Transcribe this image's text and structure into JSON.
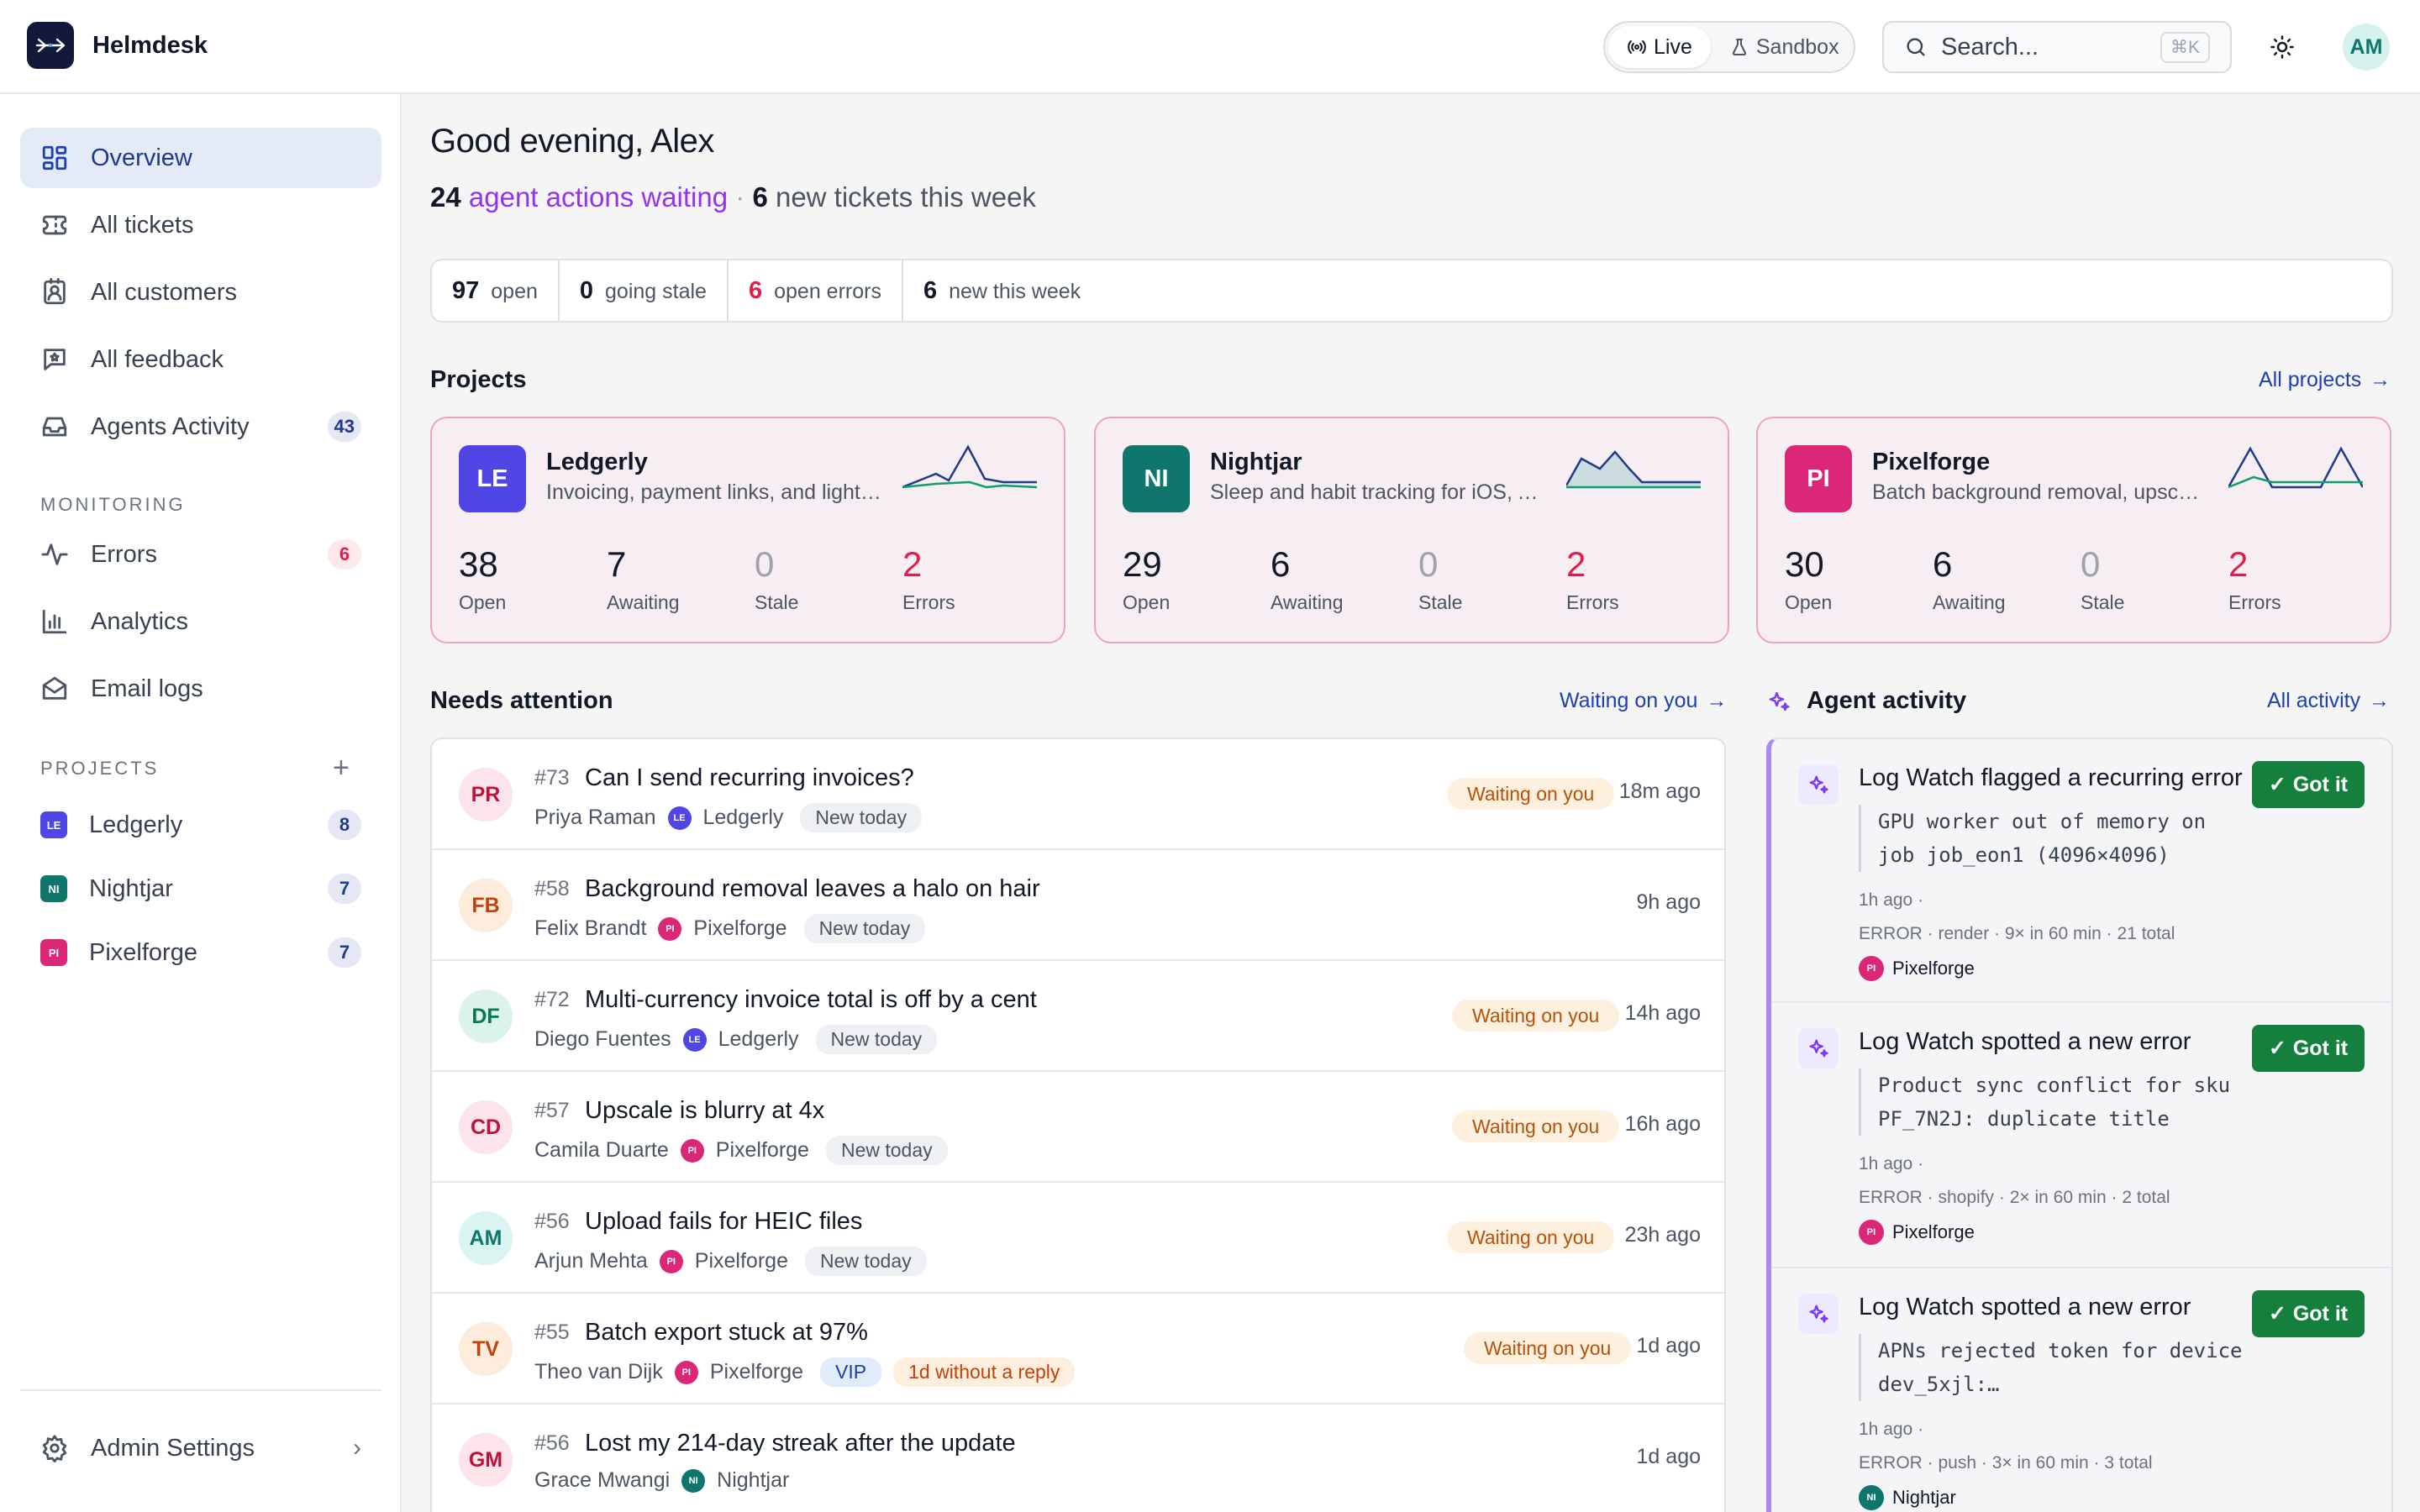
{
  "app": {
    "name": "Helmdesk"
  },
  "header": {
    "mode_live": "Live",
    "mode_sandbox": "Sandbox",
    "search_placeholder": "Search...",
    "search_shortcut": "⌘K",
    "user_initials": "AM"
  },
  "sidebar": {
    "nav": [
      {
        "label": "Overview",
        "icon": "grid-icon",
        "active": true
      },
      {
        "label": "All tickets",
        "icon": "ticket-icon"
      },
      {
        "label": "All customers",
        "icon": "contact-icon"
      },
      {
        "label": "All feedback",
        "icon": "feedback-icon"
      },
      {
        "label": "Agents Activity",
        "icon": "inbox-icon",
        "badge": "43"
      }
    ],
    "monitoring_title": "MONITORING",
    "monitoring": [
      {
        "label": "Errors",
        "icon": "pulse-icon",
        "badge": "6"
      },
      {
        "label": "Analytics",
        "icon": "bar-chart-icon"
      },
      {
        "label": "Email logs",
        "icon": "mail-icon"
      }
    ],
    "projects_title": "PROJECTS",
    "projects": [
      {
        "label": "Ledgerly",
        "chip": "LE",
        "color": "#4f46e5",
        "badge": "8"
      },
      {
        "label": "Nightjar",
        "chip": "NI",
        "color": "#0f766e",
        "badge": "7"
      },
      {
        "label": "Pixelforge",
        "chip": "PI",
        "color": "#db2777",
        "badge": "7"
      }
    ],
    "admin": "Admin Settings"
  },
  "main": {
    "greeting": "Good evening, Alex",
    "summary": {
      "actions_count": "24",
      "actions_text": "agent actions waiting",
      "sep": "·",
      "new_count": "6",
      "new_text": "new tickets this week"
    },
    "stats": [
      {
        "value": "97",
        "label": "open"
      },
      {
        "value": "0",
        "label": "going stale"
      },
      {
        "value": "6",
        "label": "open errors",
        "red": true
      },
      {
        "value": "6",
        "label": "new this week"
      }
    ],
    "projects_title": "Projects",
    "projects_link": "All projects",
    "project_cards": [
      {
        "chip": "LE",
        "color": "#4f46e5",
        "name": "Ledgerly",
        "desc": "Invoicing, payment links, and light bookkeeping",
        "open": "38",
        "awaiting": "7",
        "stale": "0",
        "errors": "2"
      },
      {
        "chip": "NI",
        "color": "#0f766e",
        "name": "Nightjar",
        "desc": "Sleep and habit tracking for iOS, Android",
        "open": "29",
        "awaiting": "6",
        "stale": "0",
        "errors": "2"
      },
      {
        "chip": "PI",
        "color": "#db2777",
        "name": "Pixelforge",
        "desc": "Batch background removal, upscaling",
        "open": "30",
        "awaiting": "6",
        "stale": "0",
        "errors": "2"
      }
    ],
    "metric_labels": {
      "open": "Open",
      "awaiting": "Awaiting",
      "stale": "Stale",
      "errors": "Errors"
    },
    "attention_title": "Needs attention",
    "attention_link": "Waiting on you",
    "tickets": [
      {
        "initials": "PR",
        "av_bg": "#fde4ea",
        "av_fg": "#be123c",
        "num": "#73",
        "title": "Can I send recurring invoices?",
        "person": "Priya Raman",
        "project": "Ledgerly",
        "pchip": "LE",
        "pcolor": "#4f46e5",
        "tags": [
          "New today"
        ],
        "status": "Waiting on you",
        "ago": "18m ago"
      },
      {
        "initials": "FB",
        "av_bg": "#fdecdc",
        "av_fg": "#c2410c",
        "num": "#58",
        "title": "Background removal leaves a halo on hair",
        "person": "Felix Brandt",
        "project": "Pixelforge",
        "pchip": "PI",
        "pcolor": "#db2777",
        "tags": [
          "New today"
        ],
        "status": "",
        "ago": "9h ago"
      },
      {
        "initials": "DF",
        "av_bg": "#dcf3ea",
        "av_fg": "#047857",
        "num": "#72",
        "title": "Multi-currency invoice total is off by a cent",
        "person": "Diego Fuentes",
        "project": "Ledgerly",
        "pchip": "LE",
        "pcolor": "#4f46e5",
        "tags": [
          "New today"
        ],
        "status": "Waiting on you",
        "ago": "14h ago"
      },
      {
        "initials": "CD",
        "av_bg": "#fde4ea",
        "av_fg": "#be123c",
        "num": "#57",
        "title": "Upscale is blurry at 4x",
        "person": "Camila Duarte",
        "project": "Pixelforge",
        "pchip": "PI",
        "pcolor": "#db2777",
        "tags": [
          "New today"
        ],
        "status": "Waiting on you",
        "ago": "16h ago"
      },
      {
        "initials": "AM",
        "av_bg": "#d9f4f1",
        "av_fg": "#0f766e",
        "num": "#56",
        "title": "Upload fails for HEIC files",
        "person": "Arjun Mehta",
        "project": "Pixelforge",
        "pchip": "PI",
        "pcolor": "#db2777",
        "tags": [
          "New today"
        ],
        "status": "Waiting on you",
        "ago": "23h ago"
      },
      {
        "initials": "TV",
        "av_bg": "#fdecdc",
        "av_fg": "#c2410c",
        "num": "#55",
        "title": "Batch export stuck at 97%",
        "person": "Theo van Dijk",
        "project": "Pixelforge",
        "pchip": "PI",
        "pcolor": "#db2777",
        "tags": [
          "VIP",
          "1d without a reply"
        ],
        "status": "Waiting on you",
        "ago": "1d ago"
      },
      {
        "initials": "GM",
        "av_bg": "#fde4ea",
        "av_fg": "#be123c",
        "num": "#56",
        "title": "Lost my 214-day streak after the update",
        "person": "Grace Mwangi",
        "project": "Nightjar",
        "pchip": "NI",
        "pcolor": "#0f766e",
        "tags": [],
        "status": "",
        "ago": "1d ago"
      }
    ],
    "activity_title": "Agent activity",
    "activity_link": "All activity",
    "activity": [
      {
        "title": "Log Watch flagged a recurring error",
        "button": "Got it",
        "code": "GPU worker out of memory on job job_eon1 (4096×4096)",
        "time": "1h ago ·",
        "meta": "ERROR · render · 9× in 60 min · 21 total",
        "project": "Pixelforge",
        "pchip": "PI",
        "pcolor": "#db2777"
      },
      {
        "title": "Log Watch spotted a new error",
        "button": "Got it",
        "code": "Product sync conflict for sku PF_7N2J: duplicate title",
        "time": "1h ago ·",
        "meta": "ERROR · shopify · 2× in 60 min · 2 total",
        "project": "Pixelforge",
        "pchip": "PI",
        "pcolor": "#db2777"
      },
      {
        "title": "Log Watch spotted a new error",
        "button": "Got it",
        "code": "APNs rejected token for device dev_5xjl:…",
        "time": "1h ago ·",
        "meta": "ERROR · push · 3× in 60 min · 3 total",
        "project": "Nightjar",
        "pchip": "NI",
        "pcolor": "#0f766e"
      }
    ]
  }
}
